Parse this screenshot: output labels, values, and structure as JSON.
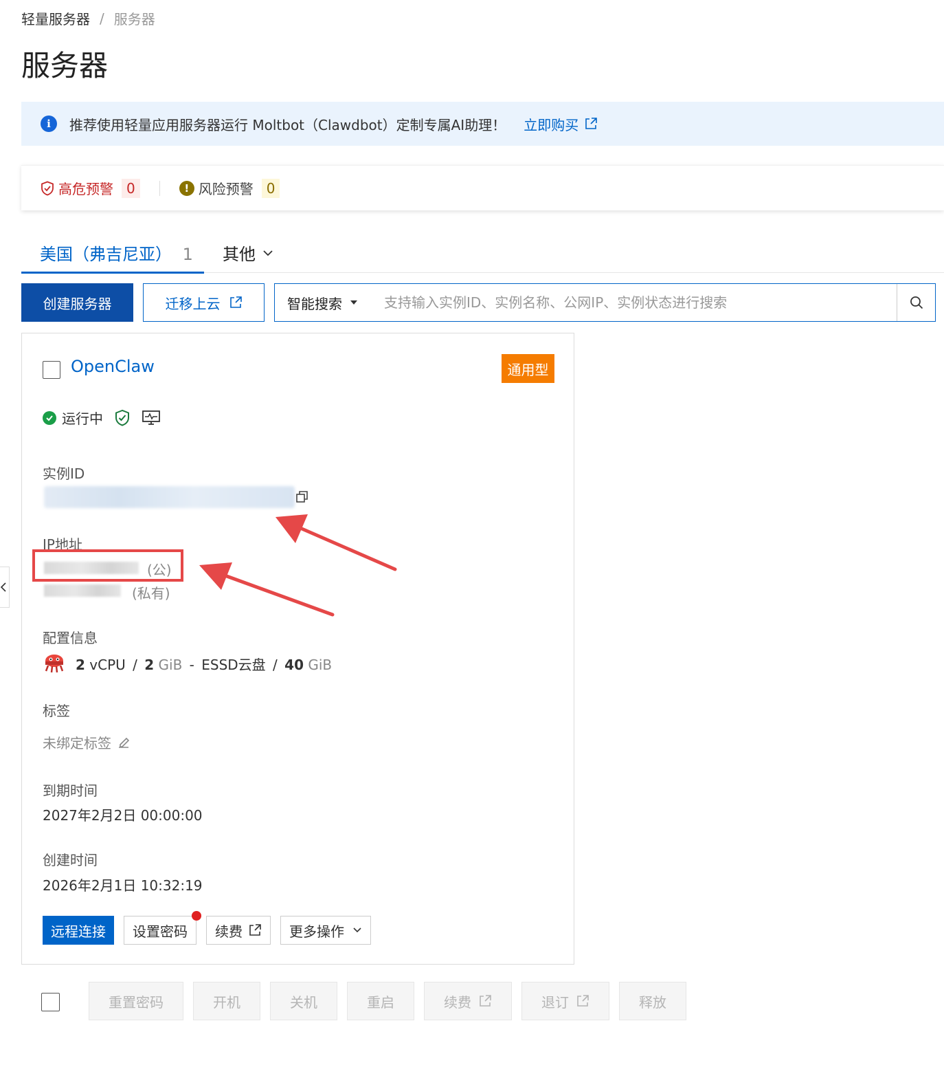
{
  "breadcrumb": {
    "parent": "轻量服务器",
    "separator": "/",
    "current": "服务器"
  },
  "page_title": "服务器",
  "notice": {
    "text": "推荐使用轻量应用服务器运行 Moltbot（Clawdbot）定制专属AI助理！",
    "link_label": "立即购买"
  },
  "alerts": {
    "high_label": "高危预警",
    "high_count": "0",
    "risk_label": "风险预警",
    "risk_count": "0"
  },
  "tabs": {
    "region_label": "美国（弗吉尼亚）",
    "region_count": "1",
    "other_label": "其他"
  },
  "toolbar": {
    "create_label": "创建服务器",
    "migrate_label": "迁移上云",
    "search_mode": "智能搜索",
    "search_placeholder": "支持输入实例ID、实例名称、公网IP、实例状态进行搜索"
  },
  "instance": {
    "name": "OpenClaw",
    "type_badge": "通用型",
    "status": "运行中",
    "id_label": "实例ID",
    "ip_label": "IP地址",
    "public_suffix": "(公)",
    "private_suffix": "(私有)",
    "config_label": "配置信息",
    "spec": {
      "cpu_num": "2",
      "cpu_unit": "vCPU",
      "sep1": "/",
      "mem_num": "2",
      "mem_unit": "GiB",
      "dash": "-",
      "disk_type": "ESSD云盘",
      "sep2": "/",
      "disk_num": "40",
      "disk_unit": "GiB"
    },
    "tag_label": "标签",
    "tag_value": "未绑定标签",
    "expire_label": "到期时间",
    "expire_value": "2027年2月2日 00:00:00",
    "created_label": "创建时间",
    "created_value": "2026年2月1日 10:32:19",
    "actions": {
      "remote": "远程连接",
      "set_password": "设置密码",
      "renew": "续费",
      "more": "更多操作"
    }
  },
  "batch_actions": [
    "重置密码",
    "开机",
    "关机",
    "重启",
    "续费",
    "退订",
    "释放"
  ],
  "colors": {
    "primary": "#0064c8",
    "create_button": "#0d4ea6",
    "badge": "#f57c00",
    "annotation": "#e54848",
    "running": "#1a9e48",
    "high_alert": "#c62828"
  }
}
